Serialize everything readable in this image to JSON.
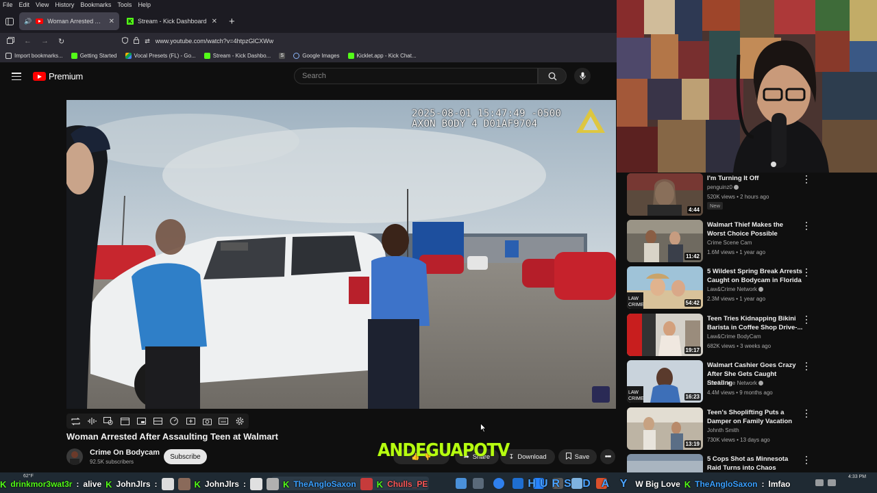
{
  "menubar": {
    "items": [
      "File",
      "Edit",
      "View",
      "History",
      "Bookmarks",
      "Tools",
      "Help"
    ]
  },
  "tabs": [
    {
      "title": "Woman Arrested After Assa",
      "active": true,
      "icon": "youtube-favicon"
    },
    {
      "title": "Stream - Kick Dashboard",
      "active": false,
      "icon": "kick-favicon"
    }
  ],
  "address_bar": {
    "url": "www.youtube.com/watch?v=4htpzGlCXWw"
  },
  "bookmarks": [
    {
      "label": "Import bookmarks...",
      "color": "#e0e0e0"
    },
    {
      "label": "Getting Started",
      "color": "#53fc18"
    },
    {
      "label": "Vocal Presets (FL) - Go...",
      "color": "#f4b400"
    },
    {
      "label": "Stream - Kick Dashbo...",
      "color": "#53fc18"
    },
    {
      "label": "",
      "color": "#cccccc"
    },
    {
      "label": "Google Images",
      "color": "#8ab4f8"
    },
    {
      "label": "Kicklet.app - Kick Chat...",
      "color": "#53fc18"
    }
  ],
  "youtube": {
    "logo_text": "Premium",
    "search_placeholder": "Search"
  },
  "video": {
    "timestamp_line1": "2025-08-01 15:47:49 -0500",
    "timestamp_line2": "AXON BODY 4 D01AF9704",
    "title": "Woman Arrested After Assaulting Teen at Walmart",
    "channel": "Crime On Bodycam",
    "subscribers": "92.5K subscribers",
    "subscribe_label": "Subscribe",
    "share_label": "Share",
    "download_label": "Download",
    "save_label": "Save"
  },
  "stream_overlay": {
    "name": "ANDEGUAPOTV"
  },
  "recommendations": [
    {
      "title": "I'm Turning It Off",
      "channel": "penguinz0",
      "verified": true,
      "meta": "520K views • 2 hours ago",
      "duration": "4:44",
      "badge": "New",
      "thumb_color": "#6a5a4a"
    },
    {
      "title": "Walmart Thief Makes the Worst Choice Possible",
      "channel": "Crime Scene Cam",
      "verified": false,
      "meta": "1.6M views • 1 year ago",
      "duration": "11:42",
      "badge": "",
      "thumb_color": "#8a7a6a"
    },
    {
      "title": "5 Wildest Spring Break Arrests Caught on Bodycam in Florida",
      "channel": "Law&Crime Network",
      "verified": true,
      "meta": "2.3M views • 1 year ago",
      "duration": "54:42",
      "badge": "",
      "thumb_color": "#d8b48a"
    },
    {
      "title": "Teen Tries Kidnapping Bikini Barista in Coffee Shop Drive-...",
      "channel": "Law&Crime BodyCam",
      "verified": false,
      "meta": "682K views • 3 weeks ago",
      "duration": "19:17",
      "badge": "",
      "thumb_color": "#c23a3a"
    },
    {
      "title": "Walmart Cashier Goes Crazy After She Gets Caught Stealing",
      "channel": "Law&Crime Network",
      "verified": true,
      "meta": "4.4M views • 9 months ago",
      "duration": "16:23",
      "badge": "",
      "thumb_color": "#5a6f8a"
    },
    {
      "title": "Teen's Shoplifting Puts a Damper on Family Vacation",
      "channel": "Johnth Smith",
      "verified": false,
      "meta": "730K views • 13 days ago",
      "duration": "13:19",
      "badge": "",
      "thumb_color": "#b8a890"
    },
    {
      "title": "5 Cops Shot as Minnesota Raid Turns into Chaos",
      "channel": "",
      "verified": false,
      "meta": "",
      "duration": "",
      "badge": "",
      "thumb_color": "#7d8fa3"
    }
  ],
  "chat_ticker": [
    {
      "user": "drinkmor3wat3r",
      "message": "alive"
    },
    {
      "user": "JohnJlrs",
      "message": ""
    },
    {
      "user": "JohnJlrs",
      "message": ""
    },
    {
      "user": "TheAngloSaxon",
      "message": ""
    },
    {
      "user": "Chulls_PE",
      "message": ""
    },
    {
      "user": "",
      "message": "HURS D A Y"
    },
    {
      "user": "",
      "message": "W Big Love"
    },
    {
      "user": "TheAngloSaxon",
      "message": "lmfao"
    }
  ],
  "taskbar": {
    "weather": "62°F",
    "clock": "4:33 PM"
  }
}
